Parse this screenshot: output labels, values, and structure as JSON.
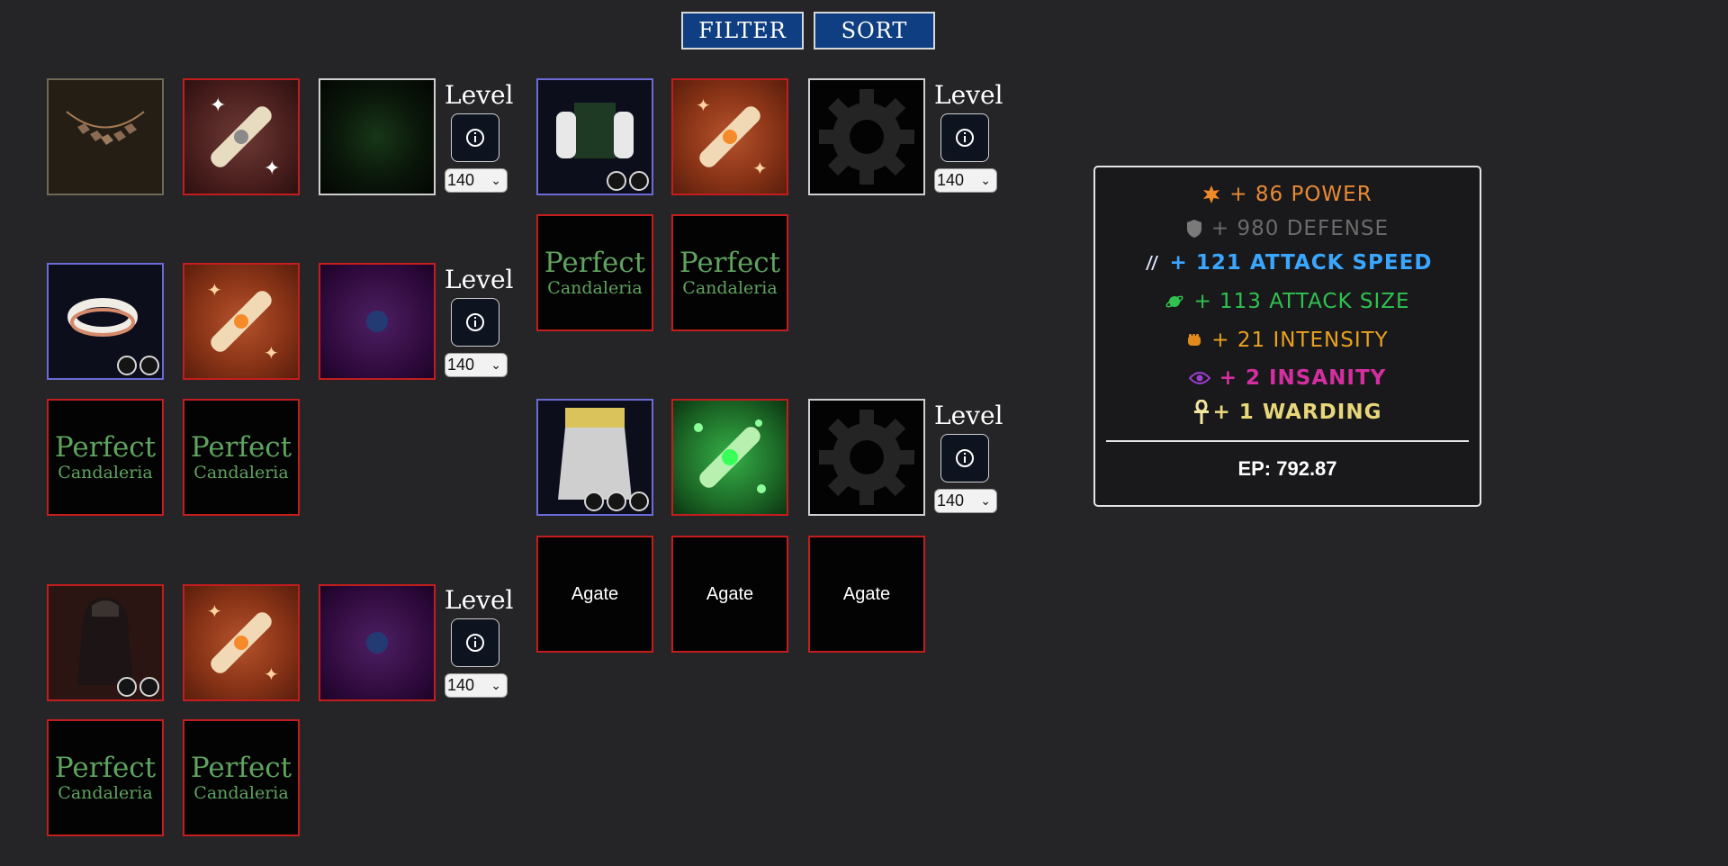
{
  "toolbar": {
    "filter_label": "FILTER",
    "sort_label": "SORT"
  },
  "level_label": "Level",
  "level_value": "140",
  "perfect_top": "Perfect",
  "perfect_bottom": "Candaleria",
  "agate_label": "Agate",
  "stats": {
    "power": {
      "text": "+ 86 POWER",
      "color": "#e98a35",
      "icon": "burst-icon"
    },
    "defense": {
      "text": "+ 980 DEFENSE",
      "color": "#6b6b6b",
      "icon": "shield-icon"
    },
    "attack_speed": {
      "text": "+ 121 ATTACK SPEED",
      "color": "#3aa6ff",
      "icon": "claw-icon"
    },
    "attack_size": {
      "text": "+ 113 ATTACK SIZE",
      "color": "#2fc24f",
      "icon": "planet-icon"
    },
    "intensity": {
      "text": "+ 21 INTENSITY",
      "color": "#e9a21e",
      "icon": "fist-icon"
    },
    "insanity": {
      "text": "+ 2 INSANITY",
      "color": "#d42fa0",
      "icon": "eye-icon"
    },
    "warding": {
      "text": "+ 1 WARDING",
      "color": "#e8d77a",
      "icon": "ankh-icon"
    }
  },
  "ep_text": "EP: 792.87"
}
